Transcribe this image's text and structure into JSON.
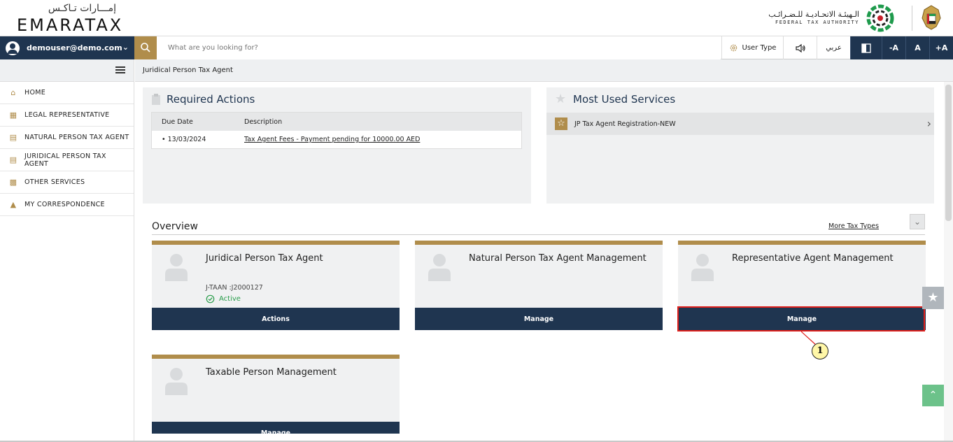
{
  "header": {
    "logo_ar": "إمـــارات تـاكـس",
    "logo_en": "EMARATAX",
    "fta_ar": "الـهيئـة الاتحـاديـة للـضـرائـب",
    "fta_en": "FEDERAL TAX AUTHORITY"
  },
  "toolbar": {
    "user_email": "demouser@demo.com",
    "search_placeholder": "What are you looking for?",
    "user_type_label": "User Type",
    "audio_icon": "speaker-icon",
    "arabic_label": "عربي",
    "contrast_icon": "contrast-icon",
    "font_decrease": "-A",
    "font_normal": "A",
    "font_increase": "+A"
  },
  "sidebar": {
    "items": [
      {
        "label": "HOME",
        "icon": "home-icon"
      },
      {
        "label": "LEGAL REPRESENTATIVE",
        "icon": "legal-rep-icon"
      },
      {
        "label": "NATURAL PERSON TAX AGENT",
        "icon": "id-card-icon"
      },
      {
        "label": "JURIDICAL PERSON TAX AGENT",
        "icon": "id-card-icon"
      },
      {
        "label": "OTHER SERVICES",
        "icon": "clipboard-icon"
      },
      {
        "label": "MY CORRESPONDENCE",
        "icon": "building-icon"
      }
    ]
  },
  "breadcrumb": "Juridical Person Tax Agent",
  "required_actions": {
    "title": "Required Actions",
    "columns": [
      "Due Date",
      "Description"
    ],
    "rows": [
      {
        "due": "• 13/03/2024",
        "description": "Tax Agent Fees - Payment pending for 10000.00 AED"
      }
    ]
  },
  "most_used": {
    "title": "Most Used Services",
    "items": [
      "JP Tax Agent Registration-NEW"
    ]
  },
  "overview": {
    "title": "Overview",
    "more_link": "More Tax Types",
    "cards": [
      {
        "title": "Juridical Person Tax Agent",
        "id": "J-TAAN :J2000127",
        "status": "Active",
        "button": "Actions"
      },
      {
        "title": "Natural Person Tax Agent Management",
        "button": "Manage"
      },
      {
        "title": "Representative Agent Management",
        "button": "Manage"
      },
      {
        "title": "Taxable Person Management",
        "button": "Manage"
      }
    ]
  },
  "annotation": {
    "callout": "1"
  },
  "colors": {
    "navy": "#1f3550",
    "gold": "#b08d4b",
    "active_green": "#2a9d4b",
    "highlight_red": "#e0201c"
  }
}
